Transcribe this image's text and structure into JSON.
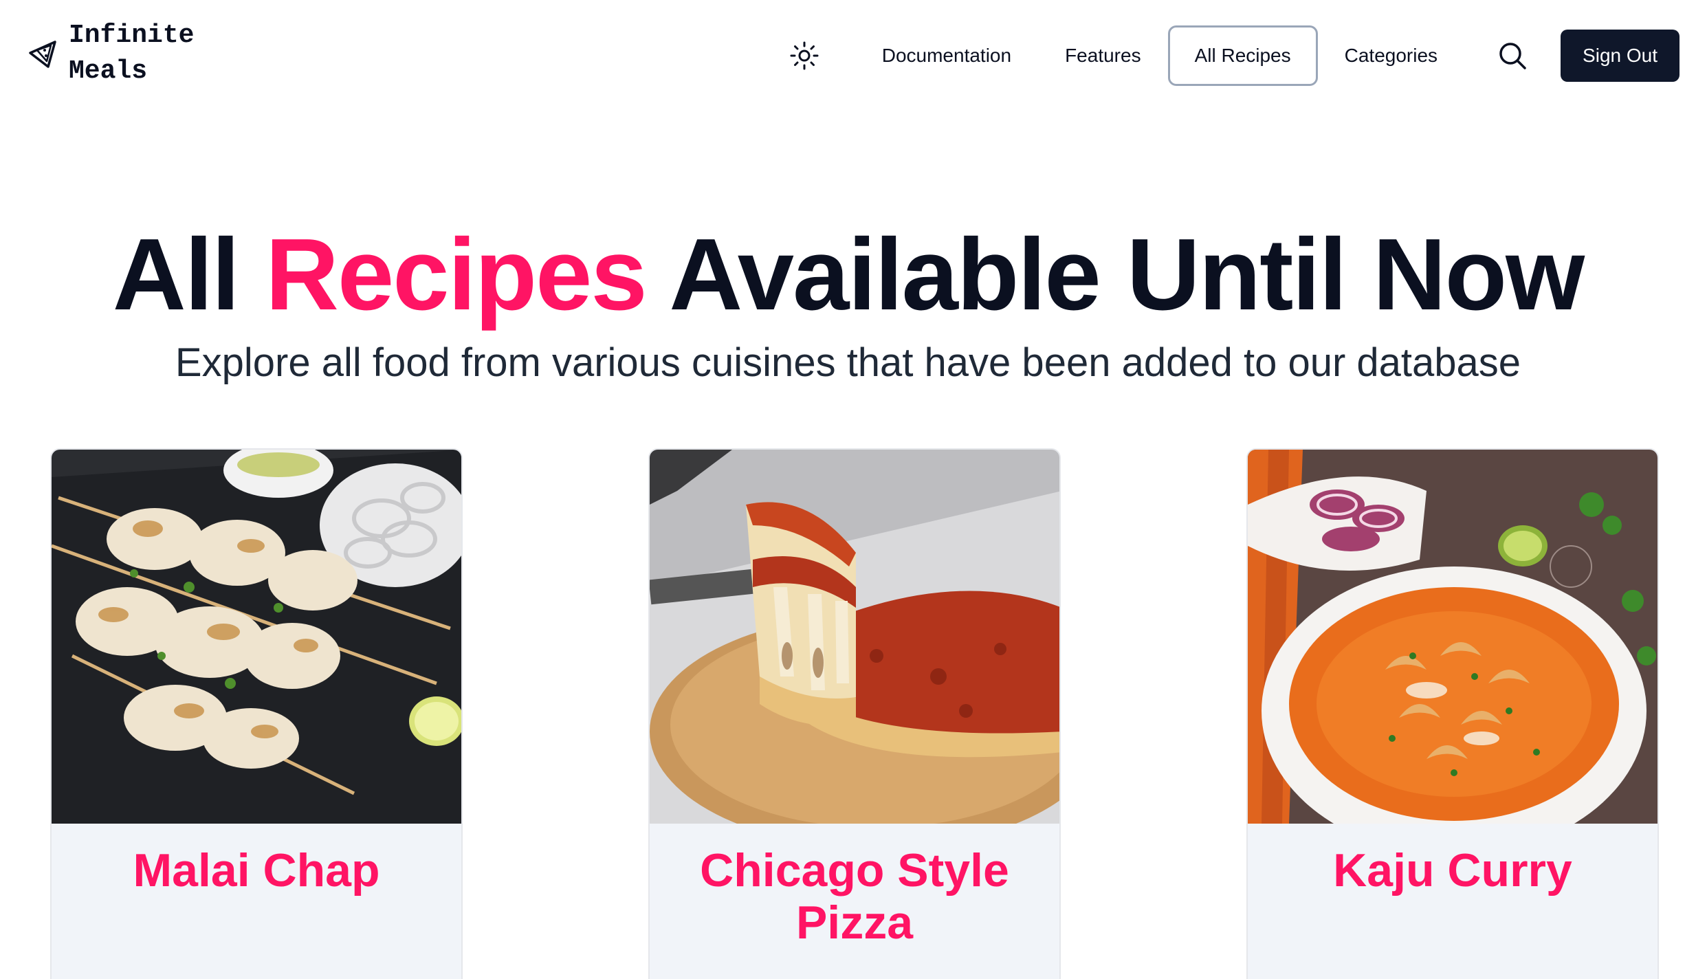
{
  "brand": {
    "line1": "Infinite",
    "line2": "Meals",
    "icon": "pizza-slice-icon"
  },
  "nav": {
    "theme_icon": "sun-icon",
    "links": [
      {
        "label": "Documentation",
        "active": false
      },
      {
        "label": "Features",
        "active": false
      },
      {
        "label": "All Recipes",
        "active": true
      },
      {
        "label": "Categories",
        "active": false
      }
    ],
    "search_icon": "search-icon",
    "signout_label": "Sign Out"
  },
  "hero": {
    "title_before": "All",
    "title_accent": "Recipes",
    "title_after": "Available Until Now",
    "subtitle": "Explore all food from various cuisines that have been added to our database"
  },
  "recipes": [
    {
      "name": "Malai Chap"
    },
    {
      "name": "Chicago Style Pizza"
    },
    {
      "name": "Kaju Curry"
    }
  ],
  "colors": {
    "accent": "#ff1464",
    "dark": "#0f172a",
    "card_bg": "#f1f4f9"
  }
}
